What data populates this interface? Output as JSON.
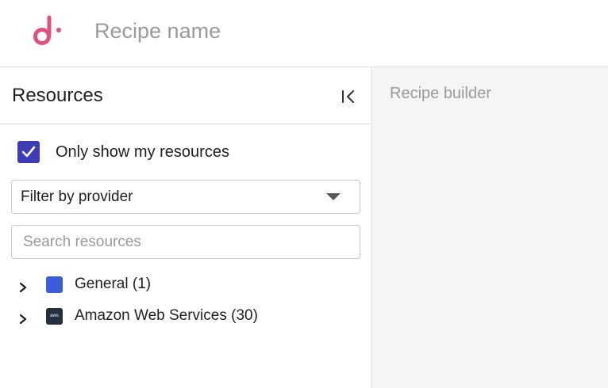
{
  "header": {
    "logo": "d-logo-icon",
    "recipe_name": "Recipe name"
  },
  "sidebar": {
    "title": "Resources",
    "collapse_icon": "collapse-left-icon",
    "only_mine": {
      "label": "Only show my resources",
      "checked": true
    },
    "filter": {
      "value": "Filter by provider"
    },
    "search": {
      "placeholder": "Search resources",
      "value": ""
    },
    "tree": [
      {
        "label": "General (1)",
        "icon": "general-square-icon",
        "color": "#3c5cdc",
        "expanded": false
      },
      {
        "label": "Amazon Web Services (30)",
        "icon": "aws-icon",
        "icon_text": "aws",
        "expanded": false
      }
    ]
  },
  "builder": {
    "title": "Recipe builder"
  },
  "colors": {
    "brand": "#e0527e",
    "checkbox": "#3d3cb4",
    "general": "#3c5cdc",
    "aws": "#232f3e"
  }
}
